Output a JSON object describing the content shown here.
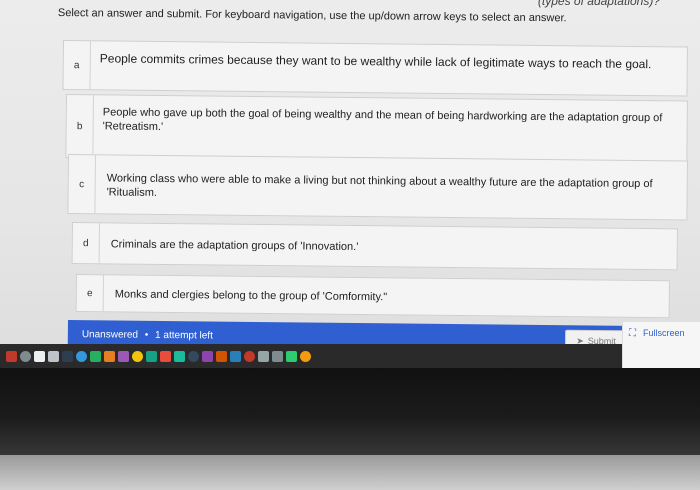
{
  "header": {
    "top_cut_text": "(types of adaptations)?",
    "instruction": "Select an answer and submit. For keyboard navigation, use the up/down arrow keys to select an answer."
  },
  "choices": [
    {
      "letter": "a",
      "text": "People commits crimes because they want to be wealthy while lack of legitimate ways to reach the goal."
    },
    {
      "letter": "b",
      "text": "People who gave up both the goal of being wealthy and the mean of being hardworking are the adaptation group of 'Retreatism.'"
    },
    {
      "letter": "c",
      "text": "Working class who were able to make a living but not thinking about a wealthy future are the adaptation group of 'Ritualism."
    },
    {
      "letter": "d",
      "text": "Criminals are the adaptation groups of 'Innovation.'"
    },
    {
      "letter": "e",
      "text": "Monks and clergies belong to the group of 'Comformity.\""
    }
  ],
  "status": {
    "state": "Unanswered",
    "separator": "•",
    "attempts": "1 attempt left"
  },
  "submit": {
    "label": "Submit",
    "icon": "send-icon"
  },
  "fullscreen": {
    "label": "Fullscreen",
    "icon": "fullscreen-icon"
  },
  "colors": {
    "accent": "#2f5fd0",
    "background": "#ececec"
  },
  "taskbar_icons": [
    "#c0392b",
    "#7f8c8d",
    "#ecf0f1",
    "#bdc3c7",
    "#2c3e50",
    "#3498db",
    "#27ae60",
    "#e67e22",
    "#9b59b6",
    "#f1c40f",
    "#16a085",
    "#e74c3c",
    "#1abc9c",
    "#34495e",
    "#8e44ad",
    "#d35400",
    "#2980b9",
    "#c0392b",
    "#95a5a6",
    "#7f8c8d",
    "#2ecc71",
    "#f39c12"
  ]
}
